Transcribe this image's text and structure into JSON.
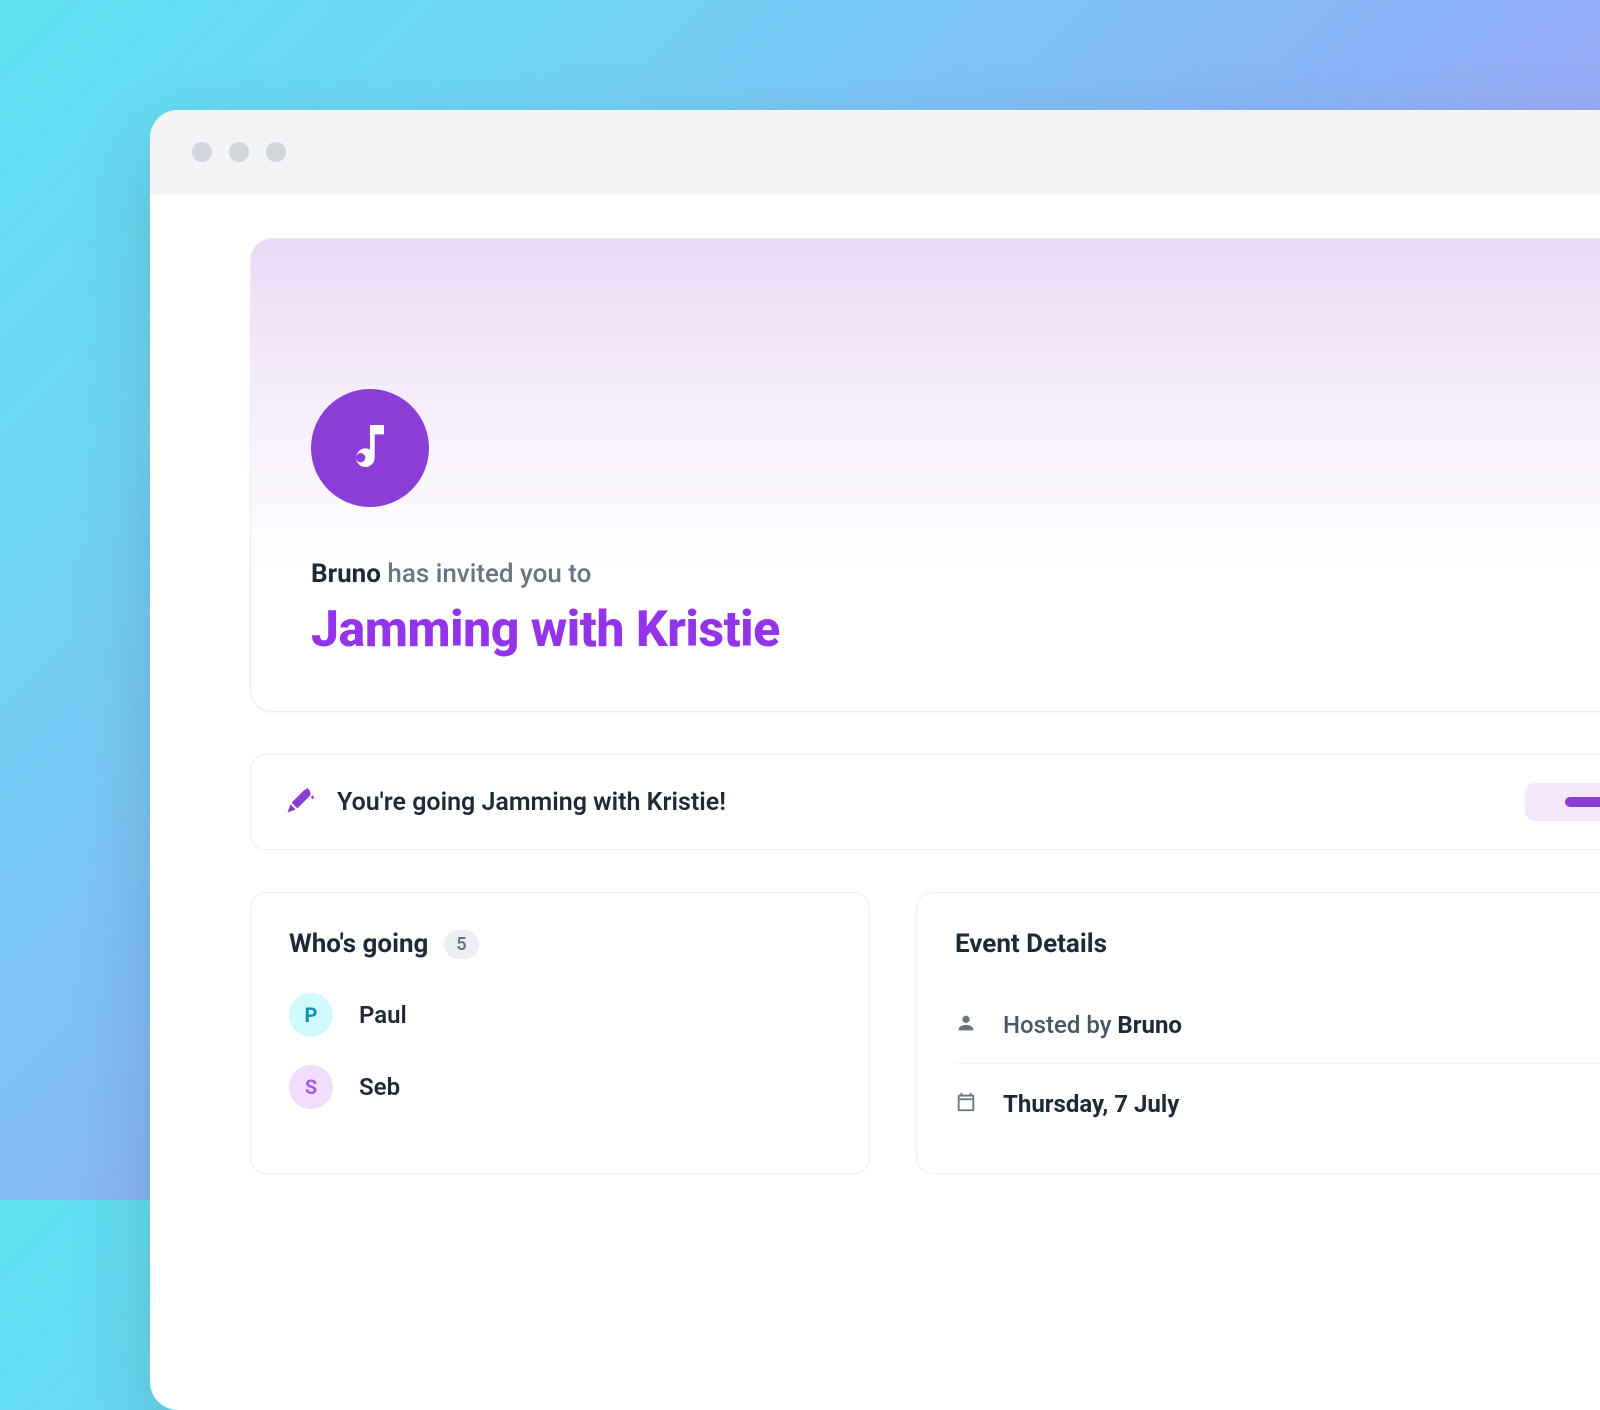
{
  "hero": {
    "inviter": "Bruno",
    "invite_suffix": " has invited you to",
    "event_title": "Jamming with Kristie"
  },
  "status": {
    "message": "You're going Jamming with Kristie!"
  },
  "attendees": {
    "title": "Who's going",
    "count": "5",
    "list": [
      {
        "initial": "P",
        "name": "Paul"
      },
      {
        "initial": "S",
        "name": "Seb"
      }
    ]
  },
  "details": {
    "title": "Event Details",
    "hosted_prefix": "Hosted by ",
    "host": "Bruno",
    "date": "Thursday, 7 July"
  }
}
